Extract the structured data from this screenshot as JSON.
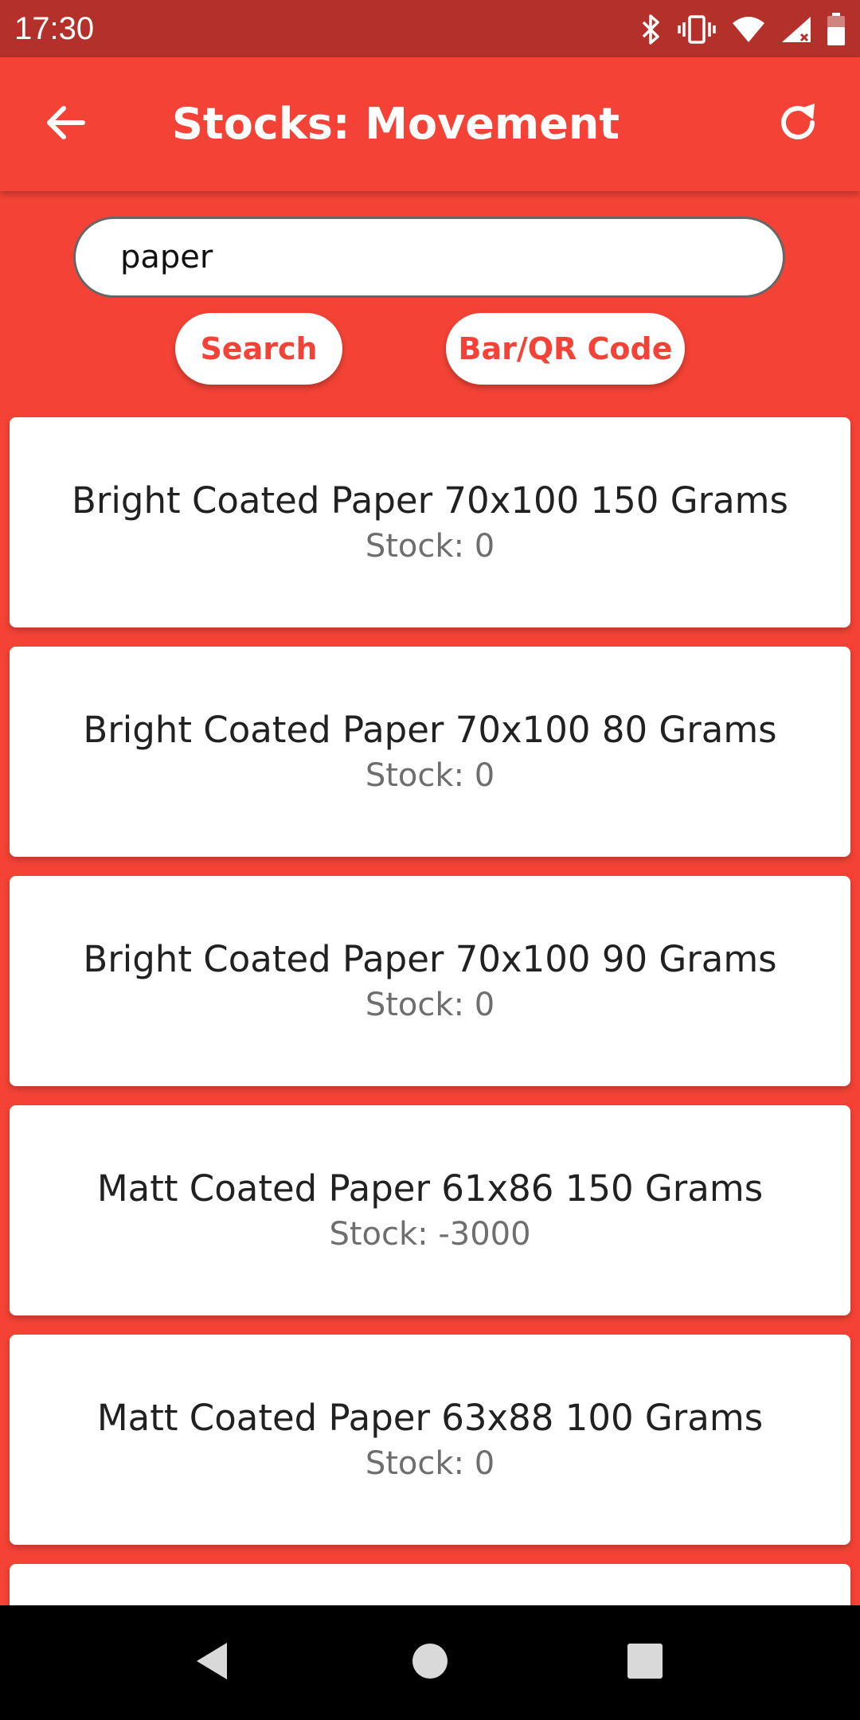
{
  "status_bar": {
    "time": "17:30",
    "icons": [
      "bluetooth-icon",
      "vibrate-icon",
      "wifi-icon",
      "cell-signal-icon",
      "battery-icon"
    ]
  },
  "app_bar": {
    "title": "Stocks: Movement",
    "back_icon": "arrow-back-icon",
    "refresh_icon": "refresh-icon"
  },
  "search": {
    "value": "paper",
    "search_label": "Search",
    "code_label": "Bar/QR Code"
  },
  "items": [
    {
      "name": "Bright Coated Paper 70x100 150 Grams",
      "stock": "Stock: 0"
    },
    {
      "name": "Bright Coated Paper 70x100 80 Grams",
      "stock": "Stock: 0"
    },
    {
      "name": "Bright Coated Paper 70x100 90 Grams",
      "stock": "Stock: 0"
    },
    {
      "name": "Matt Coated Paper 61x86 150 Grams",
      "stock": "Stock: -3000"
    },
    {
      "name": "Matt Coated Paper 63x88 100 Grams",
      "stock": "Stock: 0"
    },
    {
      "name": "",
      "stock": ""
    }
  ],
  "colors": {
    "primary": "#f44336",
    "status_bar": "#b3312a",
    "card": "#ffffff",
    "nav_bar": "#000000"
  }
}
